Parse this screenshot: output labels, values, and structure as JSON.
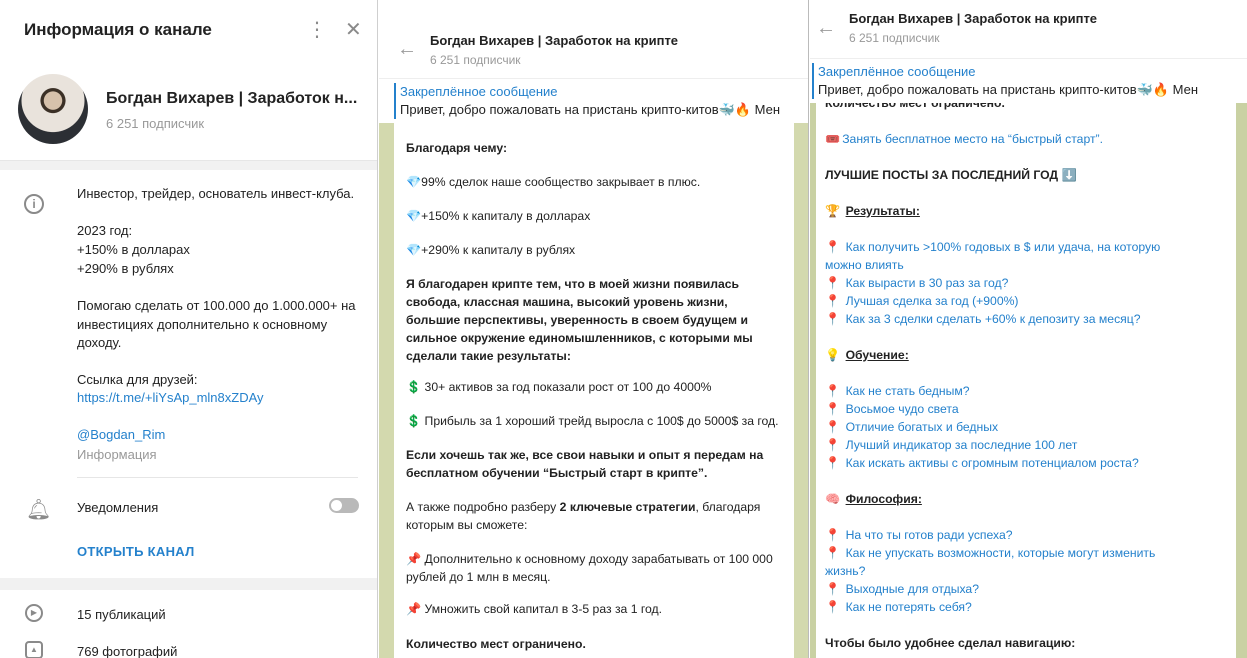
{
  "info_panel": {
    "title": "Информация о канале",
    "channel_name": "Богдан Вихарев | Заработок н...",
    "subscribers": "6 251 подписчик",
    "description": {
      "line1": "Инвестор, трейдер, основатель инвест-клуба.",
      "year": "2023 год:",
      "usd": "+150% в долларах",
      "rub": "+290% в рублях",
      "help1": "Помогаю сделать от 100.000 до 1.000.000+ на",
      "help2": "инвестициях дополнительно к основному",
      "help3": "доходу.",
      "link_label": "Ссылка для друзей:",
      "link": "https://t.me/+liYsAp_mln8xZDAy"
    },
    "username": "@Bogdan_Rim",
    "username_caption": "Информация",
    "notifications_label": "Уведомления",
    "notifications_on": false,
    "open_channel": "ОТКРЫТЬ КАНАЛ",
    "posts": "15 публикаций",
    "photos": "769 фотографий"
  },
  "chat1": {
    "title": "Богдан Вихарев | Заработок на крипте",
    "subscribers": "6 251 подписчик",
    "pin_title": "Закреплённое сообщение",
    "pin_text": "Привет, добро пожаловать на пристань крипто-китов🐳🔥  Мен",
    "lines": {
      "l1": "Благодаря чему:",
      "l2": "💎99% сделок наше сообщество закрывает в плюс.",
      "l3": "💎+150% к капиталу в долларах",
      "l4": "💎+290% к капиталу в рублях",
      "l5a": "Я благодарен крипте тем, что в моей жизни появилась",
      "l5b": "свобода, классная машина, высокий уровень жизни,",
      "l5c": "большие перспективы, уверенность в своем будущем и",
      "l5d": "сильное окружение единомышленников, с которыми мы",
      "l5e": "сделали такие результаты:",
      "l6": "💲 30+ активов за год показали рост от 100 до 4000%",
      "l7": "💲 Прибыль за 1 хороший трейд выросла с 100$ до 5000$ за год.",
      "l8a": "Если хочешь так же, все свои навыки и опыт я передам на",
      "l8b": "бесплатном обучении “Быстрый старт в крипте”.",
      "l9a_pre": "А также подробно разберу ",
      "l9a_bold": "2 ключевые стратегии",
      "l9a_post": ", благодаря",
      "l9b": "которым вы сможете:",
      "l10a": "📌 Дополнительно к основному доходу зарабатывать от 100 000",
      "l10b": "рублей до 1 млн в месяц.",
      "l11": "📌 Умножить свой капитал в 3-5 раз за 1 год.",
      "l12": "Количество мест ограничено."
    }
  },
  "chat2": {
    "title": "Богдан Вихарев | Заработок на крипте",
    "subscribers": "6 251 подписчик",
    "pin_title": "Закреплённое сообщение",
    "pin_text": "Привет, добро пожаловать на пристань крипто-китов🐳🔥  Мен",
    "top_cut": "Количество мест ограничено.",
    "free_seat": "Занять бесплатное место на “быстрый старт”.",
    "best_posts": "ЛУЧШИЕ ПОСТЫ ЗА ПОСЛЕДНИЙ ГОД ⬇️",
    "results_heading": "Результаты:",
    "results": [
      "Как получить >100% годовых в $ или удача, на которую",
      "можно влиять",
      "Как вырасти в 30 раз за год?",
      "Лучшая сделка за год (+900%)",
      "Как за 3 сделки сделать +60% к депозиту за месяц?"
    ],
    "edu_heading": "Обучение:",
    "edu": [
      "Как не стать бедным?",
      "Восьмое чудо света",
      "Отличие богатых и бедных",
      "Лучший индикатор за последние 100 лет",
      "Как искать активы с огромным потенциалом роста?"
    ],
    "philo_heading": "Философия:",
    "philo": [
      "На что ты готов ради успеха?",
      "Как не упускать возможности, которые могут изменить",
      "жизнь?",
      "Выходные для отдыха?",
      "Как не потерять себя?"
    ],
    "nav": "Чтобы было удобнее сделал навигацию:"
  }
}
